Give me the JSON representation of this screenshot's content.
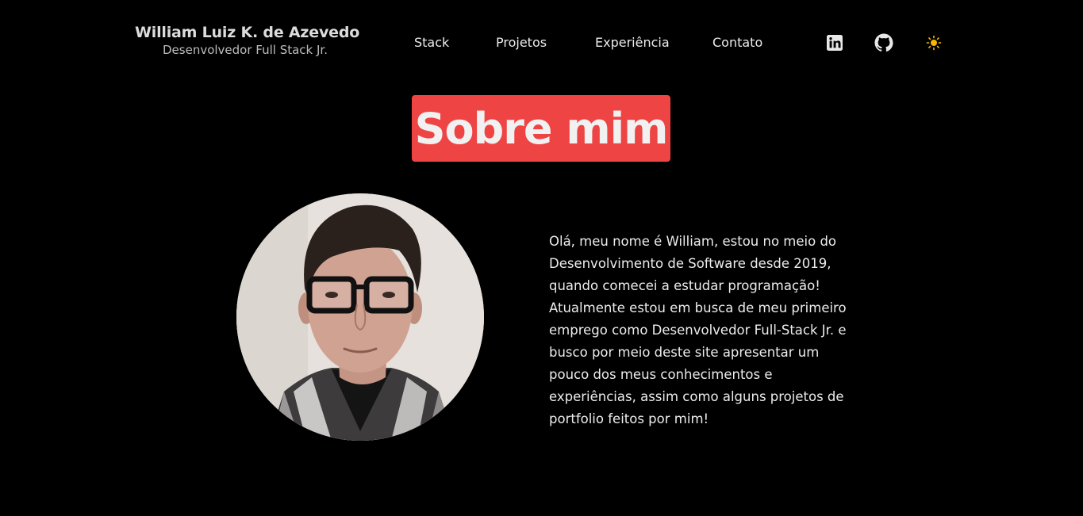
{
  "header": {
    "name": "William Luiz K. de Azevedo",
    "role": "Desenvolvedor Full Stack Jr."
  },
  "nav": {
    "items": [
      {
        "label": "Stack"
      },
      {
        "label": "Projetos"
      },
      {
        "label": "Experiência"
      },
      {
        "label": "Contato"
      }
    ]
  },
  "actions": {
    "icons": [
      "linkedin-icon",
      "github-icon",
      "sun-icon"
    ]
  },
  "about": {
    "title": "Sobre mim",
    "bio": "Olá, meu nome é William, estou no meio do Desenvolvimento de Software desde 2019, quando comecei a estudar programação! Atualmente estou em busca de meu primeiro emprego como Desenvolvedor Full-Stack Jr. e busco por meio deste site apresentar um pouco dos meus conhecimentos e experiências, assim como alguns projetos de portfolio feitos por mim!"
  },
  "colors": {
    "background": "#000000",
    "accent": "#ef4444",
    "sun": "#f5b800"
  }
}
